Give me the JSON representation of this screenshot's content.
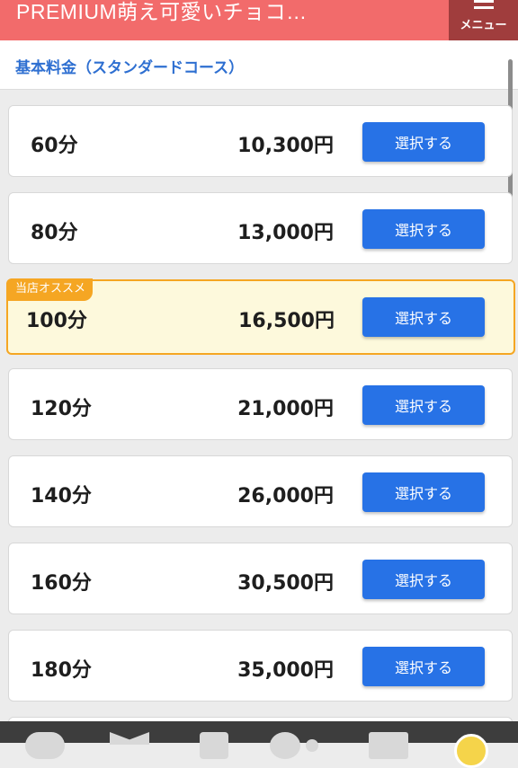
{
  "header": {
    "title": "PREMIUM萌え可愛いチョコ…",
    "menu_label": "メニュー"
  },
  "course_section": {
    "heading": "基本料金（スタンダードコース）"
  },
  "badge_text": "当店オススメ",
  "select_label": "選択する",
  "prices": [
    {
      "duration": "60分",
      "price": "10,300円"
    },
    {
      "duration": "80分",
      "price": "13,000円"
    },
    {
      "duration": "100分",
      "price": "16,500円",
      "featured": true
    },
    {
      "duration": "120分",
      "price": "21,000円"
    },
    {
      "duration": "140分",
      "price": "26,000円"
    },
    {
      "duration": "160分",
      "price": "30,500円"
    },
    {
      "duration": "180分",
      "price": "35,000円"
    }
  ],
  "colors": {
    "header_bg": "#f26b6b",
    "menu_bg": "#a03d3d",
    "accent_blue": "#2772e6",
    "featured_border": "#f5a623",
    "featured_bg": "#fdf9dc"
  },
  "bottom_bar_icons": [
    "chat-icon",
    "mail-icon",
    "phone-icon",
    "circle-icon",
    "card-icon",
    "user-icon"
  ]
}
